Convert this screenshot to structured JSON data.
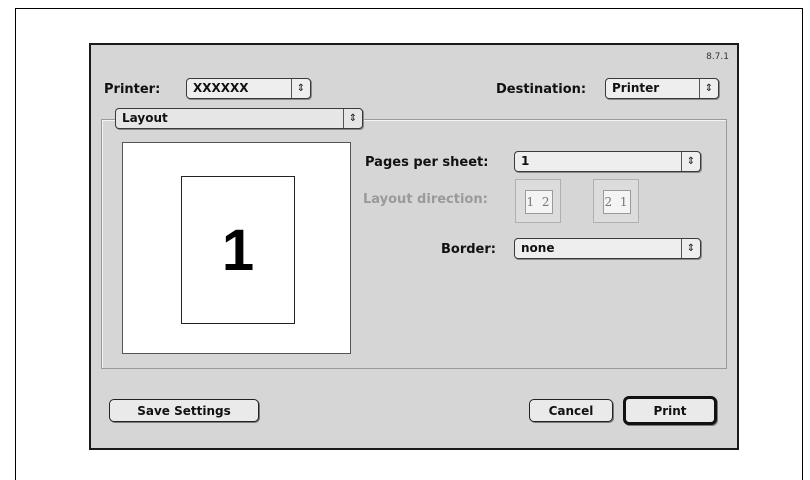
{
  "version": "8.7.1",
  "printer": {
    "label": "Printer:",
    "value": "XXXXXX"
  },
  "destination": {
    "label": "Destination:",
    "value": "Printer"
  },
  "panel_menu": {
    "value": "Layout"
  },
  "preview": {
    "page_number": "1"
  },
  "pages_per_sheet": {
    "label": "Pages per sheet:",
    "value": "1"
  },
  "layout_direction": {
    "label": "Layout direction:",
    "options": [
      {
        "text": "1 2",
        "icon": "left-to-right-icon"
      },
      {
        "text": "2 1",
        "icon": "right-to-left-icon"
      }
    ]
  },
  "border": {
    "label": "Border:",
    "value": "none"
  },
  "buttons": {
    "save_settings": "Save Settings",
    "cancel": "Cancel",
    "print": "Print"
  },
  "popup_arrow_glyph": "⇕"
}
